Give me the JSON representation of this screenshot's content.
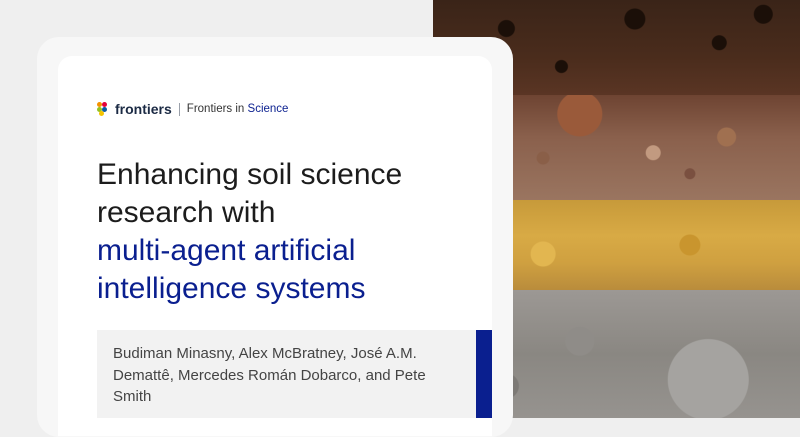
{
  "brand": {
    "name": "frontiers",
    "journal_prefix": "Frontiers in",
    "journal_name": "Science",
    "colors": {
      "accent": "#0a1f8f",
      "logo_orange": "#f39200",
      "logo_red": "#e4003a",
      "logo_green": "#96c11f",
      "logo_blue": "#0a5ba3"
    }
  },
  "article": {
    "title_line_1": "Enhancing soil science",
    "title_line_2": "research with",
    "title_line_3": "multi-agent artificial",
    "title_line_4": "intelligence systems",
    "authors": "Budiman Minasny, Alex McBratney, José A.M. Demattê, Mercedes Román Dobarco, and Pete Smith"
  },
  "image": {
    "description_icon": "soil-profile-photo"
  }
}
